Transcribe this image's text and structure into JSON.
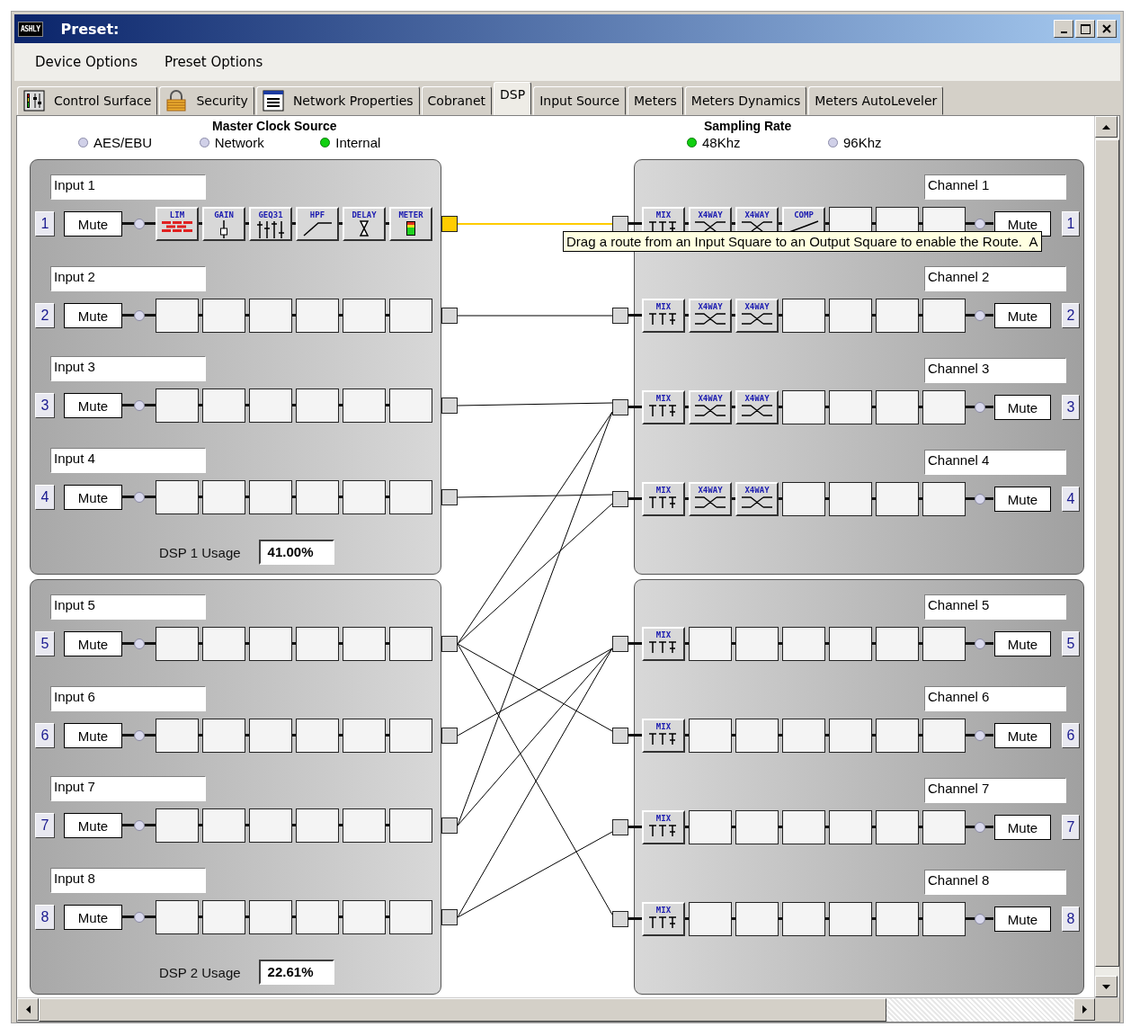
{
  "window": {
    "logo": "ASHLY",
    "title": "Preset:"
  },
  "menu": [
    "Device Options",
    "Preset Options"
  ],
  "tabs": [
    {
      "label": "Control Surface",
      "selected": false
    },
    {
      "label": "Security",
      "selected": false
    },
    {
      "label": "Network Properties",
      "selected": false
    },
    {
      "label": "Cobranet",
      "selected": false
    },
    {
      "label": "DSP",
      "selected": true
    },
    {
      "label": "Input Source",
      "selected": false
    },
    {
      "label": "Meters",
      "selected": false
    },
    {
      "label": "Meters Dynamics",
      "selected": false
    },
    {
      "label": "Meters AutoLeveler",
      "selected": false
    }
  ],
  "clock": {
    "title": "Master Clock Source",
    "options": [
      {
        "label": "AES/EBU",
        "selected": false
      },
      {
        "label": "Network",
        "selected": false
      },
      {
        "label": "Internal",
        "selected": true
      }
    ]
  },
  "sampling": {
    "title": "Sampling Rate",
    "options": [
      {
        "label": "48Khz",
        "selected": true
      },
      {
        "label": "96Khz",
        "selected": false
      }
    ]
  },
  "dsp_groups": [
    {
      "inputs": [
        {
          "number": "1",
          "name": "Input 1",
          "mute": "Mute",
          "selected": true,
          "routes": [
            true,
            false,
            false,
            false,
            false,
            false,
            false,
            false
          ],
          "modules": [
            {
              "kind": "lim",
              "label": "LIM"
            },
            {
              "kind": "gain",
              "label": "GAIN"
            },
            {
              "kind": "geq",
              "label": "GEQ31"
            },
            {
              "kind": "hpf",
              "label": "HPF"
            },
            {
              "kind": "delay",
              "label": "DELAY"
            },
            {
              "kind": "meter",
              "label": "METER"
            }
          ]
        },
        {
          "number": "2",
          "name": "Input 2",
          "mute": "Mute",
          "selected": false,
          "routes": [
            false,
            true,
            false,
            false,
            false,
            false,
            false,
            false
          ],
          "modules": [
            {
              "kind": "empty"
            },
            {
              "kind": "empty"
            },
            {
              "kind": "empty"
            },
            {
              "kind": "empty"
            },
            {
              "kind": "empty"
            },
            {
              "kind": "empty"
            }
          ]
        },
        {
          "number": "3",
          "name": "Input 3",
          "mute": "Mute",
          "selected": false,
          "routes": [
            false,
            false,
            true,
            false,
            false,
            false,
            false,
            false
          ],
          "modules": [
            {
              "kind": "empty"
            },
            {
              "kind": "empty"
            },
            {
              "kind": "empty"
            },
            {
              "kind": "empty"
            },
            {
              "kind": "empty"
            },
            {
              "kind": "empty"
            }
          ]
        },
        {
          "number": "4",
          "name": "Input 4",
          "mute": "Mute",
          "selected": false,
          "routes": [
            false,
            false,
            false,
            true,
            false,
            false,
            false,
            false
          ],
          "modules": [
            {
              "kind": "empty"
            },
            {
              "kind": "empty"
            },
            {
              "kind": "empty"
            },
            {
              "kind": "empty"
            },
            {
              "kind": "empty"
            },
            {
              "kind": "empty"
            }
          ]
        }
      ],
      "outputs": [
        {
          "number": "1",
          "name": "Channel 1",
          "mute": "Mute",
          "modules": [
            {
              "kind": "mix",
              "label": "MIX"
            },
            {
              "kind": "x4way",
              "label": "X4WAY"
            },
            {
              "kind": "x4way",
              "label": "X4WAY"
            },
            {
              "kind": "comp",
              "label": "COMP"
            },
            {
              "kind": "empty"
            },
            {
              "kind": "empty"
            },
            {
              "kind": "empty"
            }
          ]
        },
        {
          "number": "2",
          "name": "Channel 2",
          "mute": "Mute",
          "modules": [
            {
              "kind": "mix",
              "label": "MIX"
            },
            {
              "kind": "x4way",
              "label": "X4WAY"
            },
            {
              "kind": "x4way",
              "label": "X4WAY"
            },
            {
              "kind": "empty"
            },
            {
              "kind": "empty"
            },
            {
              "kind": "empty"
            },
            {
              "kind": "empty"
            }
          ]
        },
        {
          "number": "3",
          "name": "Channel 3",
          "mute": "Mute",
          "modules": [
            {
              "kind": "mix",
              "label": "MIX"
            },
            {
              "kind": "x4way",
              "label": "X4WAY"
            },
            {
              "kind": "x4way",
              "label": "X4WAY"
            },
            {
              "kind": "empty"
            },
            {
              "kind": "empty"
            },
            {
              "kind": "empty"
            },
            {
              "kind": "empty"
            }
          ]
        },
        {
          "number": "4",
          "name": "Channel 4",
          "mute": "Mute",
          "modules": [
            {
              "kind": "mix",
              "label": "MIX"
            },
            {
              "kind": "x4way",
              "label": "X4WAY"
            },
            {
              "kind": "x4way",
              "label": "X4WAY"
            },
            {
              "kind": "empty"
            },
            {
              "kind": "empty"
            },
            {
              "kind": "empty"
            },
            {
              "kind": "empty"
            }
          ]
        }
      ],
      "usage_label": "DSP 1 Usage",
      "usage": "41.00%"
    },
    {
      "inputs": [
        {
          "number": "5",
          "name": "Input 5",
          "mute": "Mute",
          "selected": false,
          "routes": [
            false,
            false,
            true,
            true,
            false,
            true,
            false,
            true
          ],
          "modules": [
            {
              "kind": "empty"
            },
            {
              "kind": "empty"
            },
            {
              "kind": "empty"
            },
            {
              "kind": "empty"
            },
            {
              "kind": "empty"
            },
            {
              "kind": "empty"
            }
          ]
        },
        {
          "number": "6",
          "name": "Input 6",
          "mute": "Mute",
          "selected": false,
          "routes": [
            false,
            false,
            false,
            false,
            true,
            false,
            false,
            false
          ],
          "modules": [
            {
              "kind": "empty"
            },
            {
              "kind": "empty"
            },
            {
              "kind": "empty"
            },
            {
              "kind": "empty"
            },
            {
              "kind": "empty"
            },
            {
              "kind": "empty"
            }
          ]
        },
        {
          "number": "7",
          "name": "Input 7",
          "mute": "Mute",
          "selected": false,
          "routes": [
            false,
            false,
            true,
            false,
            true,
            false,
            false,
            false
          ],
          "modules": [
            {
              "kind": "empty"
            },
            {
              "kind": "empty"
            },
            {
              "kind": "empty"
            },
            {
              "kind": "empty"
            },
            {
              "kind": "empty"
            },
            {
              "kind": "empty"
            }
          ]
        },
        {
          "number": "8",
          "name": "Input 8",
          "mute": "Mute",
          "selected": false,
          "routes": [
            false,
            false,
            false,
            false,
            true,
            false,
            true,
            false
          ],
          "modules": [
            {
              "kind": "empty"
            },
            {
              "kind": "empty"
            },
            {
              "kind": "empty"
            },
            {
              "kind": "empty"
            },
            {
              "kind": "empty"
            },
            {
              "kind": "empty"
            }
          ]
        }
      ],
      "outputs": [
        {
          "number": "5",
          "name": "Channel 5",
          "mute": "Mute",
          "modules": [
            {
              "kind": "mix",
              "label": "MIX"
            },
            {
              "kind": "empty"
            },
            {
              "kind": "empty"
            },
            {
              "kind": "empty"
            },
            {
              "kind": "empty"
            },
            {
              "kind": "empty"
            },
            {
              "kind": "empty"
            }
          ]
        },
        {
          "number": "6",
          "name": "Channel 6",
          "mute": "Mute",
          "modules": [
            {
              "kind": "mix",
              "label": "MIX"
            },
            {
              "kind": "empty"
            },
            {
              "kind": "empty"
            },
            {
              "kind": "empty"
            },
            {
              "kind": "empty"
            },
            {
              "kind": "empty"
            },
            {
              "kind": "empty"
            }
          ]
        },
        {
          "number": "7",
          "name": "Channel 7",
          "mute": "Mute",
          "modules": [
            {
              "kind": "mix",
              "label": "MIX"
            },
            {
              "kind": "empty"
            },
            {
              "kind": "empty"
            },
            {
              "kind": "empty"
            },
            {
              "kind": "empty"
            },
            {
              "kind": "empty"
            },
            {
              "kind": "empty"
            }
          ]
        },
        {
          "number": "8",
          "name": "Channel 8",
          "mute": "Mute",
          "modules": [
            {
              "kind": "mix",
              "label": "MIX"
            },
            {
              "kind": "empty"
            },
            {
              "kind": "empty"
            },
            {
              "kind": "empty"
            },
            {
              "kind": "empty"
            },
            {
              "kind": "empty"
            },
            {
              "kind": "empty"
            }
          ]
        }
      ],
      "usage_label": "DSP 2 Usage",
      "usage": "22.61%"
    }
  ],
  "tooltip": "Drag a route from an Input Square to an Output Square to enable the Route.  A"
}
